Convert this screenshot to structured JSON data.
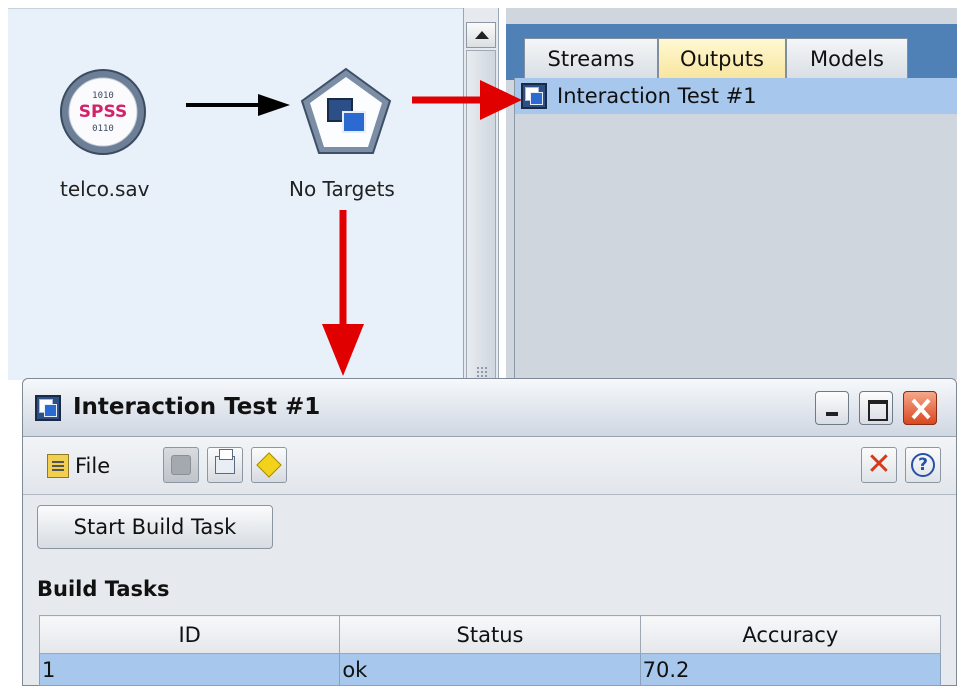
{
  "canvas": {
    "nodes": [
      {
        "label": "telco.sav",
        "icon": "spss-source-icon",
        "icon_text": "SPSS"
      },
      {
        "label": "No Targets",
        "icon": "pentagon-node-icon"
      }
    ]
  },
  "managers": {
    "tabs": [
      {
        "label": "Streams",
        "active": false
      },
      {
        "label": "Outputs",
        "active": true
      },
      {
        "label": "Models",
        "active": false
      }
    ],
    "items": [
      {
        "label": "Interaction Test #1",
        "selected": true
      }
    ]
  },
  "output_window": {
    "title": "Interaction Test #1",
    "menu": {
      "file_label": "File"
    },
    "start_button": "Start Build Task",
    "section_title": "Build Tasks",
    "table": {
      "columns": [
        "ID",
        "Status",
        "Accuracy"
      ],
      "rows": [
        {
          "id": "1",
          "status": "ok",
          "accuracy": "70.2"
        }
      ]
    }
  },
  "colors": {
    "canvas_bg": "#e8f0fa",
    "arrow_red": "#e00000",
    "arrow_black": "#000000",
    "selection": "#a7c7ec",
    "tab_strip": "#4f80b6",
    "active_tab": "#f8e6a0"
  }
}
